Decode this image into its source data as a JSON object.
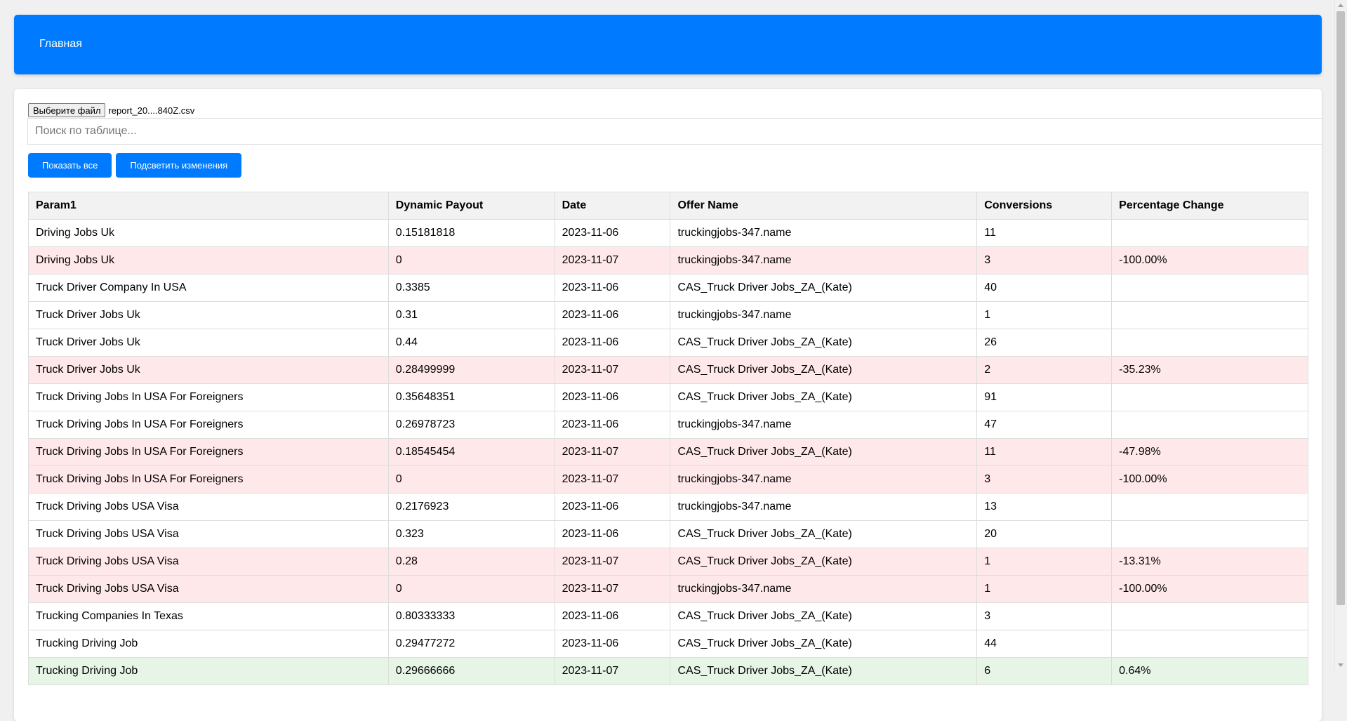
{
  "header": {
    "home_link": "Главная",
    "bg_color": "#007bff"
  },
  "file_input": {
    "button_label": "Выберите файл",
    "file_name": "report_20....840Z.csv"
  },
  "search": {
    "placeholder": "Поиск по таблице...",
    "value": ""
  },
  "buttons": {
    "show_all": "Показать все",
    "highlight_changes": "Подсветить изменения"
  },
  "colors": {
    "accent": "#007bff",
    "negative_row": "#ffe8ea",
    "positive_row": "#e6f5e6"
  },
  "table": {
    "columns": [
      "Param1",
      "Dynamic Payout",
      "Date",
      "Offer Name",
      "Conversions",
      "Percentage Change"
    ],
    "rows": [
      {
        "param1": "Driving Jobs Uk",
        "payout": "0.15181818",
        "date": "2023-11-06",
        "offer": "truckingjobs-347.name",
        "conversions": "11",
        "change": "",
        "highlight": "none"
      },
      {
        "param1": "Driving Jobs Uk",
        "payout": "0",
        "date": "2023-11-07",
        "offer": "truckingjobs-347.name",
        "conversions": "3",
        "change": "-100.00%",
        "highlight": "negative"
      },
      {
        "param1": "Truck Driver Company In USA",
        "payout": "0.3385",
        "date": "2023-11-06",
        "offer": "CAS_Truck Driver Jobs_ZA_(Kate)",
        "conversions": "40",
        "change": "",
        "highlight": "none"
      },
      {
        "param1": "Truck Driver Jobs Uk",
        "payout": "0.31",
        "date": "2023-11-06",
        "offer": "truckingjobs-347.name",
        "conversions": "1",
        "change": "",
        "highlight": "none"
      },
      {
        "param1": "Truck Driver Jobs Uk",
        "payout": "0.44",
        "date": "2023-11-06",
        "offer": "CAS_Truck Driver Jobs_ZA_(Kate)",
        "conversions": "26",
        "change": "",
        "highlight": "none"
      },
      {
        "param1": "Truck Driver Jobs Uk",
        "payout": "0.28499999",
        "date": "2023-11-07",
        "offer": "CAS_Truck Driver Jobs_ZA_(Kate)",
        "conversions": "2",
        "change": "-35.23%",
        "highlight": "negative"
      },
      {
        "param1": "Truck Driving Jobs In USA For Foreigners",
        "payout": "0.35648351",
        "date": "2023-11-06",
        "offer": "CAS_Truck Driver Jobs_ZA_(Kate)",
        "conversions": "91",
        "change": "",
        "highlight": "none"
      },
      {
        "param1": "Truck Driving Jobs In USA For Foreigners",
        "payout": "0.26978723",
        "date": "2023-11-06",
        "offer": "truckingjobs-347.name",
        "conversions": "47",
        "change": "",
        "highlight": "none"
      },
      {
        "param1": "Truck Driving Jobs In USA For Foreigners",
        "payout": "0.18545454",
        "date": "2023-11-07",
        "offer": "CAS_Truck Driver Jobs_ZA_(Kate)",
        "conversions": "11",
        "change": "-47.98%",
        "highlight": "negative"
      },
      {
        "param1": "Truck Driving Jobs In USA For Foreigners",
        "payout": "0",
        "date": "2023-11-07",
        "offer": "truckingjobs-347.name",
        "conversions": "3",
        "change": "-100.00%",
        "highlight": "negative"
      },
      {
        "param1": "Truck Driving Jobs USA Visa",
        "payout": "0.2176923",
        "date": "2023-11-06",
        "offer": "truckingjobs-347.name",
        "conversions": "13",
        "change": "",
        "highlight": "none"
      },
      {
        "param1": "Truck Driving Jobs USA Visa",
        "payout": "0.323",
        "date": "2023-11-06",
        "offer": "CAS_Truck Driver Jobs_ZA_(Kate)",
        "conversions": "20",
        "change": "",
        "highlight": "none"
      },
      {
        "param1": "Truck Driving Jobs USA Visa",
        "payout": "0.28",
        "date": "2023-11-07",
        "offer": "CAS_Truck Driver Jobs_ZA_(Kate)",
        "conversions": "1",
        "change": "-13.31%",
        "highlight": "negative"
      },
      {
        "param1": "Truck Driving Jobs USA Visa",
        "payout": "0",
        "date": "2023-11-07",
        "offer": "truckingjobs-347.name",
        "conversions": "1",
        "change": "-100.00%",
        "highlight": "negative"
      },
      {
        "param1": "Trucking Companies In Texas",
        "payout": "0.80333333",
        "date": "2023-11-06",
        "offer": "CAS_Truck Driver Jobs_ZA_(Kate)",
        "conversions": "3",
        "change": "",
        "highlight": "none"
      },
      {
        "param1": "Trucking Driving Job",
        "payout": "0.29477272",
        "date": "2023-11-06",
        "offer": "CAS_Truck Driver Jobs_ZA_(Kate)",
        "conversions": "44",
        "change": "",
        "highlight": "none"
      },
      {
        "param1": "Trucking Driving Job",
        "payout": "0.29666666",
        "date": "2023-11-07",
        "offer": "CAS_Truck Driver Jobs_ZA_(Kate)",
        "conversions": "6",
        "change": "0.64%",
        "highlight": "positive"
      }
    ]
  }
}
